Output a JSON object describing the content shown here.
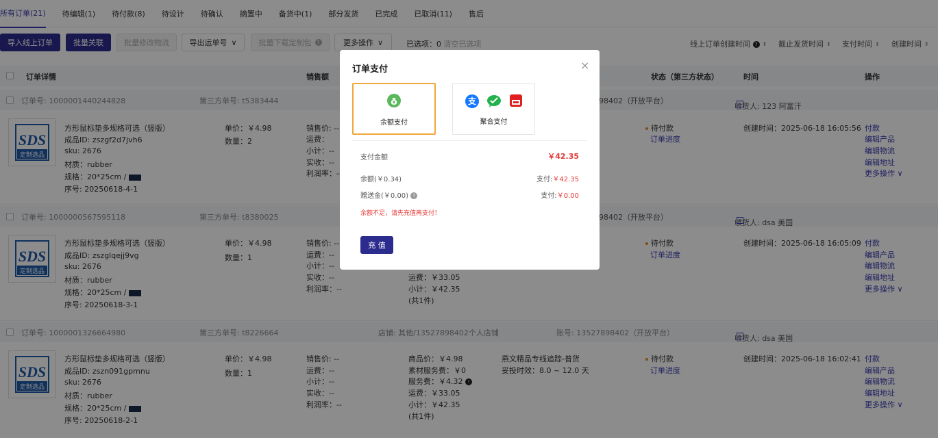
{
  "tabs": [
    "所有订单(21)",
    "待编辑(1)",
    "待付款(8)",
    "待设计",
    "待确认",
    "摘置中",
    "备货中(1)",
    "部分发货",
    "已完成",
    "已取消(11)",
    "售后"
  ],
  "toolbar": {
    "import_label": "导入线上订单",
    "bulk_link_label": "批量关联",
    "bulk_edit_logistics_label": "批量修改物流",
    "export_waybill_label": "导出运单号",
    "bulk_download_label": "批量下载定制包",
    "more_ops_label": "更多操作",
    "selected_label": "已选项：0",
    "clear_label": "清空已选项"
  },
  "sort": {
    "online_created": "线上订单创建时间",
    "ship_deadline": "截止发货时间",
    "pay_time": "支付时间",
    "created_time": "创建时间"
  },
  "table_headers": {
    "detail": "订单详情",
    "sales": "销售额",
    "status": "状态（第三方状态）",
    "time": "时间",
    "ops": "操作"
  },
  "orders": [
    {
      "order_no": "订单号: 1000001440244828",
      "third_no": "第三方单号: t5383444",
      "shop": "",
      "account": "98402（开放平台）",
      "receiver": "收货人: 123 阿富汗",
      "product_name": "方形鼠标垫多规格可选（竖版）",
      "product_id": "成品ID: zszgf2d7jvh6",
      "sku": "sku: 2676",
      "material": "材质：rubber",
      "spec": "规格：20*25cm /",
      "seq": "序号: 20250618-4-1",
      "unit_price": "单价：￥4.98",
      "qty": "数量：2",
      "sales": [
        "销售价: --",
        "运费：",
        "小计：--",
        "实收：--",
        "利润率：--"
      ],
      "fees": [],
      "logistics": [],
      "status": "待付款",
      "progress": "订单进度",
      "created": "创建时间：2025-06-18 16:05:56",
      "ops": [
        "付款",
        "编辑产品",
        "编辑物流",
        "编辑地址",
        "更多操作 ∨"
      ]
    },
    {
      "order_no": "订单号: 1000000567595118",
      "third_no": "第三方单号: t8380025",
      "shop": "",
      "account": "98402（开放平台）",
      "receiver": "收货人: dsa 美国",
      "product_name": "方形鼠标垫多规格可选（竖版）",
      "product_id": "成品ID: zszglqejj9vg",
      "sku": "sku: 2676",
      "material": "材质：rubber",
      "spec": "规格：20*25cm /",
      "seq": "序号: 20250618-3-1",
      "unit_price": "单价：￥4.98",
      "qty": "数量：1",
      "sales": [
        "销售价: --",
        "运费：--",
        "小计：--",
        "实收：--",
        "利润率：--"
      ],
      "fees": [
        "运费：￥33.05",
        "小计：￥42.35",
        "(共1件)"
      ],
      "logistics": [],
      "status": "待付款",
      "progress": "订单进度",
      "created": "创建时间：2025-06-18 16:05:09",
      "ops": [
        "付款",
        "编辑产品",
        "编辑物流",
        "编辑地址",
        "更多操作 ∨"
      ]
    },
    {
      "order_no": "订单号: 1000001326664980",
      "third_no": "第三方单号: t8226664",
      "shop": "店铺: 其他/13527898402个人店铺",
      "account": "账号: 13527898402（开放平台）",
      "receiver": "收货人: dsa 美国",
      "product_name": "方形鼠标垫多规格可选（竖版）",
      "product_id": "成品ID: zszn091gpmnu",
      "sku": "sku: 2676",
      "material": "材质：rubber",
      "spec": "规格：20*25cm /",
      "seq": "序号: 20250618-2-1",
      "unit_price": "单价：￥4.98",
      "qty": "数量：1",
      "sales": [
        "销售价: --",
        "运费：--",
        "小计：--",
        "实收：--",
        "利润率：--"
      ],
      "fees": [
        "商品价：￥4.98",
        "素材服务费：￥0",
        "服务费：￥4.32",
        "运费：￥33.05",
        "小计：￥42.35",
        "(共1件)"
      ],
      "logistics": [
        "燕文精品专线追踪-普货",
        "妥投时效：8.0 ~ 12.0 天"
      ],
      "status": "待付款",
      "progress": "订单进度",
      "created": "创建时间：2025-06-18 16:02:41",
      "ops": [
        "付款",
        "编辑产品",
        "编辑物流",
        "编辑地址",
        "更多操作 ∨"
      ]
    }
  ],
  "modal": {
    "title": "订单支付",
    "close": "×",
    "option_balance": "余额支付",
    "option_aggregate": "聚合支付",
    "amount_label": "支付金额",
    "amount_value": "￥42.35",
    "balance_label": "余额(￥0.34)",
    "balance_pay": "支付:￥42.35",
    "gift_label": "赠送金(￥0.00)",
    "gift_pay": "支付:￥0.00",
    "warning": "余额不足，请先充值再支付！",
    "recharge_label": "充 值"
  },
  "colors": {
    "primary": "#2c2c8e",
    "selected_border": "#f0a73b",
    "danger": "#e53935",
    "status_dot": "#f08a24"
  },
  "thumb_text": {
    "top": "SDS",
    "bottom": "定制选品"
  }
}
